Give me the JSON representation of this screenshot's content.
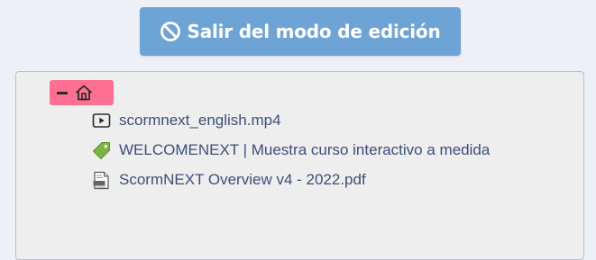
{
  "exit_edit_button": {
    "label": "Salir del modo de edición",
    "icon": "ban-icon",
    "color": "#6ea3d6"
  },
  "tree": {
    "root": {
      "icon": "home-icon",
      "toggle_icon": "collapse-icon",
      "highlight_color": "#ff6f91"
    },
    "items": [
      {
        "icon": "video-file-icon",
        "label": "scormnext_english.mp4"
      },
      {
        "icon": "tag-icon",
        "label": "WELCOMENEXT | Muestra curso interactivo a medida"
      },
      {
        "icon": "pdf-file-icon",
        "label": "ScormNEXT Overview v4 - 2022.pdf"
      }
    ]
  }
}
